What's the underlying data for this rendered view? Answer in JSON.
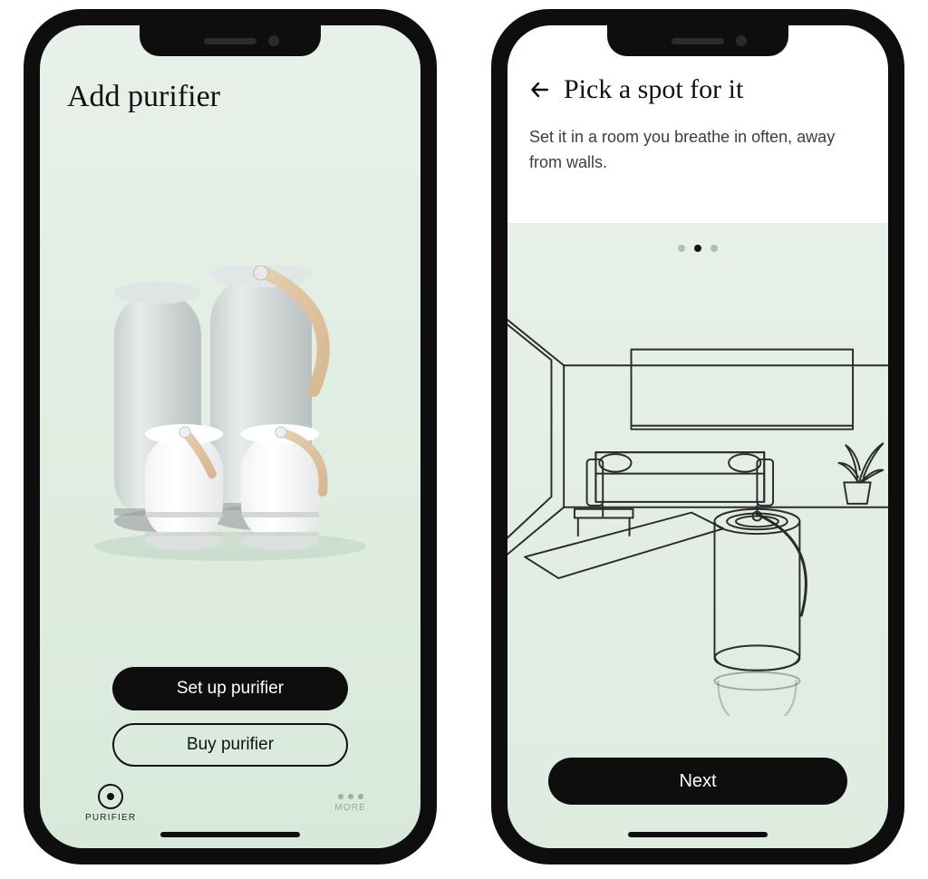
{
  "screenA": {
    "title": "Add purifier",
    "primary_button": "Set up purifier",
    "secondary_button": "Buy purifier",
    "tabs": {
      "purifier": "PURIFIER",
      "more": "MORE"
    }
  },
  "screenB": {
    "title": "Pick a spot for it",
    "subtitle": "Set it in a room you breathe in often, away from walls.",
    "next_button": "Next",
    "pagination": {
      "count": 3,
      "active": 1
    }
  },
  "colors": {
    "ink": "#0e0e0e",
    "mint_light": "#e7f1e9",
    "mint_dark": "#d8e9da"
  }
}
